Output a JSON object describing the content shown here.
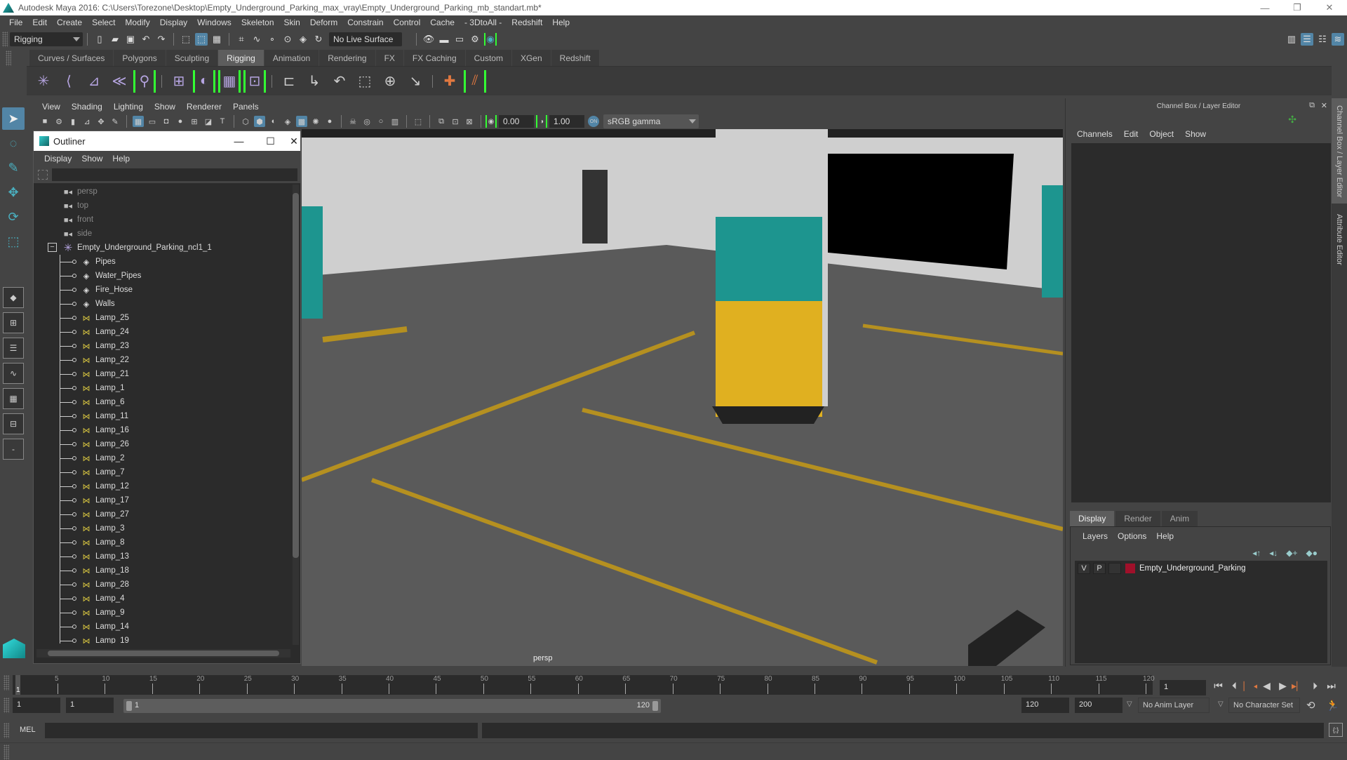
{
  "window": {
    "title": "Autodesk Maya 2016: C:\\Users\\Torezone\\Desktop\\Empty_Underground_Parking_max_vray\\Empty_Underground_Parking_mb_standart.mb*",
    "controls": {
      "minimize": "—",
      "restore": "❐",
      "close": "✕"
    }
  },
  "menubar": [
    "File",
    "Edit",
    "Create",
    "Select",
    "Modify",
    "Display",
    "Windows",
    "Skeleton",
    "Skin",
    "Deform",
    "Constrain",
    "Control",
    "Cache",
    "- 3DtoAll -",
    "Redshift",
    "Help"
  ],
  "statusline": {
    "menuset": "Rigging",
    "live_surface": "No Live Surface"
  },
  "shelf": {
    "tabs": [
      "Curves / Surfaces",
      "Polygons",
      "Sculpting",
      "Rigging",
      "Animation",
      "Rendering",
      "FX",
      "FX Caching",
      "Custom",
      "XGen",
      "Redshift"
    ],
    "active_tab": "Rigging"
  },
  "viewport": {
    "menu": [
      "View",
      "Shading",
      "Lighting",
      "Show",
      "Renderer",
      "Panels"
    ],
    "exposure": "0.00",
    "gamma": "1.00",
    "color_space": "sRGB gamma",
    "camera_label": "persp"
  },
  "outliner": {
    "title": "Outliner",
    "menu": [
      "Display",
      "Show",
      "Help"
    ],
    "search_value": "",
    "cameras": [
      "persp",
      "top",
      "front",
      "side"
    ],
    "group": "Empty_Underground_Parking_ncl1_1",
    "meshes": [
      "Pipes",
      "Water_Pipes",
      "Fire_Hose",
      "Walls"
    ],
    "lamps": [
      "Lamp_25",
      "Lamp_24",
      "Lamp_23",
      "Lamp_22",
      "Lamp_21",
      "Lamp_1",
      "Lamp_6",
      "Lamp_11",
      "Lamp_16",
      "Lamp_26",
      "Lamp_2",
      "Lamp_7",
      "Lamp_12",
      "Lamp_17",
      "Lamp_27",
      "Lamp_3",
      "Lamp_8",
      "Lamp_13",
      "Lamp_18",
      "Lamp_28",
      "Lamp_4",
      "Lamp_9",
      "Lamp_14",
      "Lamp_19"
    ]
  },
  "channel_box": {
    "title": "Channel Box / Layer Editor",
    "menu": [
      "Channels",
      "Edit",
      "Object",
      "Show"
    ]
  },
  "layer_editor": {
    "tabs": [
      "Display",
      "Render",
      "Anim"
    ],
    "active_tab": "Display",
    "menu": [
      "Layers",
      "Options",
      "Help"
    ],
    "layers": [
      {
        "v": "V",
        "p": "P",
        "name": "Empty_Underground_Parking",
        "color": "#a0102a"
      }
    ]
  },
  "side_tabs": [
    "Channel Box / Layer Editor",
    "Attribute Editor"
  ],
  "time_slider": {
    "ticks": [
      5,
      10,
      15,
      20,
      25,
      30,
      35,
      40,
      45,
      50,
      55,
      60,
      65,
      70,
      75,
      80,
      85,
      90,
      95,
      100,
      105,
      110,
      115,
      120
    ],
    "range": [
      1,
      120
    ],
    "current_frame": "1",
    "current_frame_field": "1"
  },
  "range_slider": {
    "start_time": "1",
    "playback_start": "1",
    "range_start_label": "1",
    "range_end_label": "120",
    "playback_end": "120",
    "end_time": "200",
    "anim_layer": "No Anim Layer",
    "character_set": "No Character Set"
  },
  "command_line": {
    "label": "MEL",
    "value": ""
  },
  "colors": {
    "accent": "#5285a6",
    "bracket_green": "#33ff33",
    "lamp_icon": "#d6c440",
    "group_icon": "#b5a4e0",
    "playhead_key": "#e07840"
  }
}
